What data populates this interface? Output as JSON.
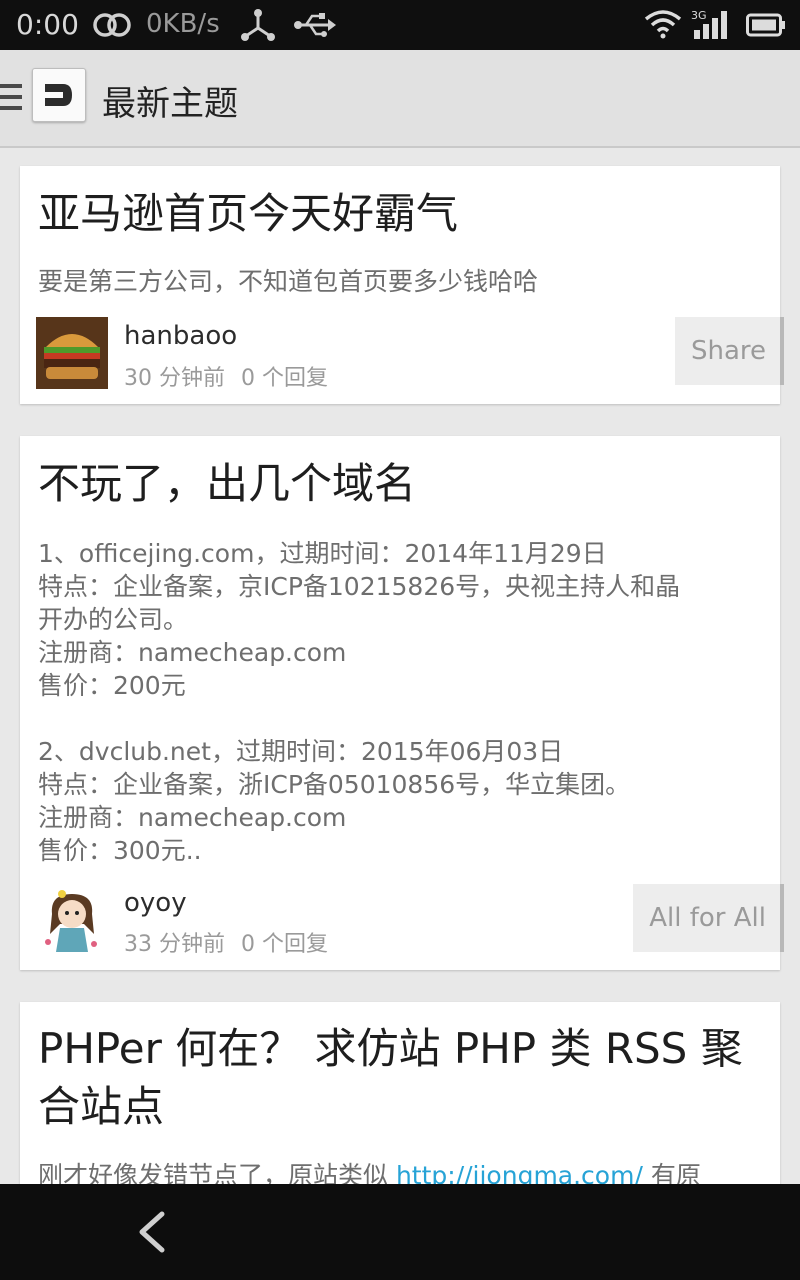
{
  "status_bar": {
    "time": "0:00",
    "speed": "0KB/s",
    "network_type": "3G",
    "icons": [
      "rings-icon",
      "fork-icon",
      "usb-icon",
      "wifi-icon",
      "signal-icon",
      "battery-icon"
    ]
  },
  "action_bar": {
    "title": "最新主题",
    "icons": [
      "hamburger-icon",
      "app-logo-icon"
    ]
  },
  "topics": [
    {
      "title": "亚马逊首页今天好霸气",
      "excerpt_lines": [
        "要是第三方公司，不知道包首页要多少钱哈哈"
      ],
      "author": "hanbaoo",
      "time": "30 分钟前",
      "replies": "0 个回复",
      "node": "Share"
    },
    {
      "title": "不玩了，出几个域名",
      "excerpt_lines": [
        "1、officejing.com，过期时间：2014年11月29日",
        "特点：企业备案，京ICP备10215826号，央视主持人和晶",
        "开办的公司。",
        "注册商：namecheap.com",
        "售价：200元",
        "",
        "2、dvclub.net，过期时间：2015年06月03日",
        "特点：企业备案，浙ICP备05010856号，华立集团。",
        "注册商：namecheap.com",
        "售价：300元.."
      ],
      "author": "oyoy",
      "time": "33 分钟前",
      "replies": "0 个回复",
      "node": "All for All"
    },
    {
      "title_line1": "PHPer 何在？ 求仿站 PHP 类 RSS 聚",
      "title_line2": "合站点",
      "excerpt_before": "刚才好像发错节点了，原站类似 ",
      "excerpt_link": "http://jiongma.com/",
      "excerpt_after": " 有原"
    }
  ],
  "nav_bar": {
    "icons": [
      "back-icon"
    ]
  },
  "colors": {
    "status_bar": "#0f0f0f",
    "action_bar": "#e1e1e1",
    "feed_background": "#e8e8e8",
    "card": "#ffffff",
    "link": "#27a3d6",
    "nav_bar": "#0d0d0d"
  }
}
